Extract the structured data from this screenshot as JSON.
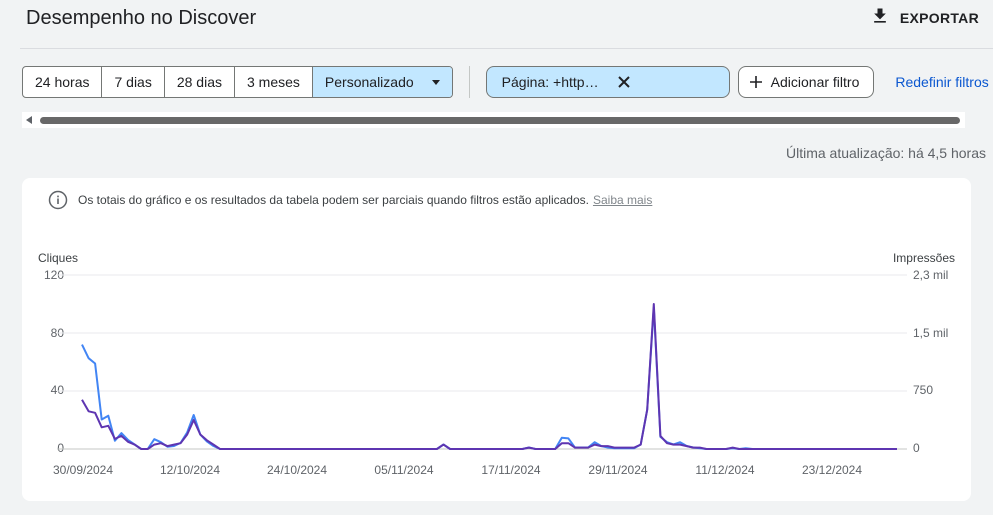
{
  "header": {
    "title": "Desempenho no Discover",
    "export_label": "EXPORTAR"
  },
  "date_ranges": {
    "options": [
      "24 horas",
      "7 dias",
      "28 dias",
      "3 meses",
      "Personalizado"
    ],
    "selected": "Personalizado"
  },
  "filters": {
    "page_chip_label": "Página: +https://backlogger...",
    "add_filter_label": "Adicionar filtro",
    "reset_label": "Redefinir filtros"
  },
  "status": {
    "last_update": "Última atualização: há 4,5 horas"
  },
  "notice": {
    "text": "Os totais do gráfico e os resultados da tabela podem ser parciais quando filtros estão aplicados.",
    "learn_more": "Saiba mais"
  },
  "chart_data": {
    "type": "line",
    "left_axis_title": "Cliques",
    "right_axis_title": "Impressões",
    "left_ticks": [
      "120",
      "80",
      "40",
      "0"
    ],
    "right_ticks": [
      "2,3 mil",
      "1,5 mil",
      "750",
      "0"
    ],
    "ylim_left": [
      0,
      120
    ],
    "ylim_right": [
      0,
      2300
    ],
    "x_tick_labels": [
      "30/09/2024",
      "12/10/2024",
      "24/10/2024",
      "05/11/2024",
      "17/11/2024",
      "29/11/2024",
      "11/12/2024",
      "23/12/2024"
    ],
    "x_start": "30/09/2024",
    "colors": {
      "clicks": "#5e35b1",
      "impressions": "#4285f4"
    },
    "series": [
      {
        "name": "Cliques",
        "axis": "left",
        "values": [
          34,
          26,
          25,
          15,
          16,
          7,
          9,
          5,
          3,
          0,
          0,
          3,
          4,
          2,
          3,
          4,
          10,
          20,
          10,
          6,
          3,
          0,
          0,
          0,
          0,
          0,
          0,
          0,
          0,
          0,
          0,
          0,
          0,
          0,
          0,
          0,
          0,
          0,
          0,
          0,
          0,
          0,
          0,
          0,
          0,
          0,
          0,
          0,
          0,
          0,
          0,
          0,
          0,
          0,
          0,
          3,
          0,
          0,
          0,
          0,
          0,
          0,
          0,
          0,
          0,
          0,
          0,
          0,
          1,
          0,
          0,
          0,
          0,
          4,
          4,
          1,
          1,
          1,
          3,
          2,
          2,
          1,
          1,
          1,
          1,
          3,
          27,
          100,
          9,
          4,
          3,
          3,
          2,
          1,
          1,
          0,
          0,
          0,
          0,
          1,
          0,
          0,
          0,
          0,
          0,
          0,
          0,
          0,
          0,
          0,
          0,
          0,
          0,
          0,
          0,
          0,
          0,
          0,
          0,
          0,
          0,
          0,
          0,
          0,
          0
        ]
      },
      {
        "name": "Impressões",
        "axis": "right",
        "values": [
          1380,
          1200,
          1130,
          390,
          440,
          110,
          210,
          120,
          60,
          0,
          0,
          130,
          90,
          30,
          40,
          80,
          220,
          450,
          190,
          100,
          40,
          0,
          0,
          0,
          0,
          0,
          0,
          0,
          0,
          0,
          0,
          0,
          0,
          0,
          0,
          0,
          0,
          0,
          0,
          0,
          0,
          0,
          0,
          0,
          0,
          0,
          0,
          0,
          0,
          0,
          0,
          0,
          0,
          0,
          0,
          60,
          0,
          0,
          0,
          0,
          0,
          0,
          0,
          0,
          0,
          0,
          0,
          0,
          20,
          0,
          0,
          0,
          0,
          150,
          140,
          20,
          20,
          20,
          90,
          40,
          20,
          10,
          10,
          10,
          10,
          60,
          520,
          1870,
          160,
          90,
          60,
          90,
          40,
          20,
          10,
          0,
          0,
          0,
          0,
          10,
          0,
          10,
          0,
          0,
          0,
          0,
          0,
          0,
          0,
          0,
          0,
          0,
          0,
          0,
          0,
          0,
          0,
          0,
          0,
          0,
          0,
          0,
          0,
          0,
          0
        ]
      }
    ]
  }
}
